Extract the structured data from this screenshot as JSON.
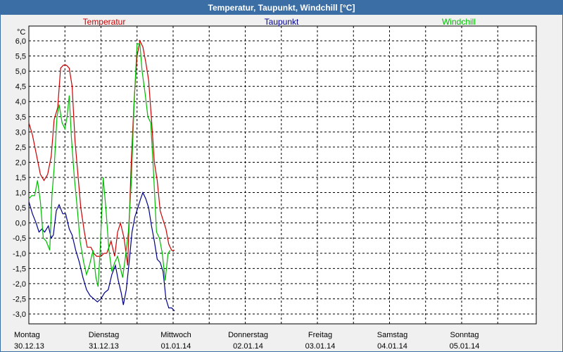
{
  "window": {
    "title": "Temperatur, Taupunkt, Windchill [°C]"
  },
  "chart_data": {
    "type": "line",
    "title": "Temperatur, Taupunkt, Windchill [°C]",
    "ylabel": "°C",
    "ylim": [
      -3.0,
      6.0
    ],
    "y_ticks": [
      "6,0",
      "5,5",
      "5,0",
      "4,5",
      "4,0",
      "3,5",
      "3,0",
      "2,5",
      "2,0",
      "1,5",
      "1,0",
      "0,5",
      "0,0",
      "-0,5",
      "-1,0",
      "-1,5",
      "-2,0",
      "-2,5",
      "-3,0"
    ],
    "xlim": [
      0,
      7
    ],
    "x_unit": "days from Montag 30.12.13",
    "x_ticks": [
      {
        "day": "Montag",
        "date": "30.12.13"
      },
      {
        "day": "Dienstag",
        "date": "31.12.13"
      },
      {
        "day": "Mittwoch",
        "date": "01.01.14"
      },
      {
        "day": "Donnerstag",
        "date": "02.01.14"
      },
      {
        "day": "Freitag",
        "date": "03.01.14"
      },
      {
        "day": "Samstag",
        "date": "04.01.14"
      },
      {
        "day": "Sonntag",
        "date": "05.01.14"
      }
    ],
    "grid": true,
    "legend_position": "top",
    "series": [
      {
        "name": "Temperatur",
        "color": "#cc0000",
        "points": [
          [
            0.0,
            3.3
          ],
          [
            0.05,
            2.9
          ],
          [
            0.1,
            2.3
          ],
          [
            0.16,
            1.6
          ],
          [
            0.21,
            1.4
          ],
          [
            0.26,
            1.6
          ],
          [
            0.31,
            2.2
          ],
          [
            0.35,
            3.4
          ],
          [
            0.4,
            3.8
          ],
          [
            0.44,
            5.1
          ],
          [
            0.48,
            5.2
          ],
          [
            0.52,
            5.2
          ],
          [
            0.56,
            5.1
          ],
          [
            0.6,
            4.5
          ],
          [
            0.64,
            2.7
          ],
          [
            0.68,
            1.6
          ],
          [
            0.72,
            0.5
          ],
          [
            0.77,
            -0.3
          ],
          [
            0.81,
            -0.8
          ],
          [
            0.86,
            -0.8
          ],
          [
            0.9,
            -1.0
          ],
          [
            0.94,
            -1.1
          ],
          [
            1.0,
            -1.1
          ],
          [
            1.04,
            -1.0
          ],
          [
            1.08,
            -1.0
          ],
          [
            1.14,
            -0.6
          ],
          [
            1.19,
            -1.1
          ],
          [
            1.23,
            -0.3
          ],
          [
            1.27,
            0.0
          ],
          [
            1.32,
            -0.5
          ],
          [
            1.37,
            -1.4
          ],
          [
            1.42,
            2.0
          ],
          [
            1.46,
            4.1
          ],
          [
            1.5,
            5.5
          ],
          [
            1.54,
            6.0
          ],
          [
            1.58,
            5.8
          ],
          [
            1.62,
            5.3
          ],
          [
            1.66,
            4.7
          ],
          [
            1.7,
            3.4
          ],
          [
            1.74,
            2.0
          ],
          [
            1.78,
            1.4
          ],
          [
            1.82,
            0.4
          ],
          [
            1.86,
            0.1
          ],
          [
            1.9,
            -0.2
          ],
          [
            1.94,
            -0.7
          ],
          [
            1.98,
            -0.9
          ],
          [
            2.02,
            -0.9
          ]
        ]
      },
      {
        "name": "Taupunkt",
        "color": "#00008b",
        "points": [
          [
            0.0,
            0.7
          ],
          [
            0.05,
            0.3
          ],
          [
            0.1,
            0.0
          ],
          [
            0.14,
            -0.3
          ],
          [
            0.18,
            -0.2
          ],
          [
            0.22,
            -0.3
          ],
          [
            0.27,
            -0.1
          ],
          [
            0.31,
            -0.5
          ],
          [
            0.34,
            -0.4
          ],
          [
            0.38,
            0.4
          ],
          [
            0.42,
            0.6
          ],
          [
            0.47,
            0.3
          ],
          [
            0.51,
            0.3
          ],
          [
            0.56,
            -0.2
          ],
          [
            0.6,
            -0.4
          ],
          [
            0.65,
            -0.9
          ],
          [
            0.7,
            -1.3
          ],
          [
            0.75,
            -1.8
          ],
          [
            0.8,
            -2.2
          ],
          [
            0.85,
            -2.4
          ],
          [
            0.9,
            -2.5
          ],
          [
            0.95,
            -2.6
          ],
          [
            1.0,
            -2.5
          ],
          [
            1.05,
            -2.3
          ],
          [
            1.1,
            -2.2
          ],
          [
            1.15,
            -1.7
          ],
          [
            1.2,
            -1.4
          ],
          [
            1.24,
            -1.9
          ],
          [
            1.28,
            -2.3
          ],
          [
            1.31,
            -2.7
          ],
          [
            1.35,
            -2.2
          ],
          [
            1.39,
            -1.3
          ],
          [
            1.43,
            -0.3
          ],
          [
            1.47,
            0.2
          ],
          [
            1.51,
            0.5
          ],
          [
            1.55,
            0.8
          ],
          [
            1.58,
            1.0
          ],
          [
            1.62,
            0.8
          ],
          [
            1.66,
            0.5
          ],
          [
            1.7,
            -0.1
          ],
          [
            1.74,
            -0.6
          ],
          [
            1.78,
            -1.2
          ],
          [
            1.82,
            -1.3
          ],
          [
            1.86,
            -1.6
          ],
          [
            1.9,
            -2.5
          ],
          [
            1.94,
            -2.8
          ],
          [
            1.98,
            -2.8
          ],
          [
            2.02,
            -2.9
          ]
        ]
      },
      {
        "name": "Windchill",
        "color": "#00bb00",
        "points": [
          [
            0.0,
            0.8
          ],
          [
            0.04,
            0.9
          ],
          [
            0.08,
            0.9
          ],
          [
            0.12,
            1.4
          ],
          [
            0.16,
            0.7
          ],
          [
            0.2,
            -0.5
          ],
          [
            0.24,
            -0.6
          ],
          [
            0.29,
            -0.9
          ],
          [
            0.32,
            0.9
          ],
          [
            0.35,
            1.8
          ],
          [
            0.39,
            3.5
          ],
          [
            0.42,
            3.9
          ],
          [
            0.46,
            3.3
          ],
          [
            0.5,
            3.1
          ],
          [
            0.53,
            3.5
          ],
          [
            0.56,
            4.2
          ],
          [
            0.59,
            2.8
          ],
          [
            0.63,
            1.5
          ],
          [
            0.67,
            0.5
          ],
          [
            0.71,
            -0.6
          ],
          [
            0.76,
            -1.3
          ],
          [
            0.8,
            -1.7
          ],
          [
            0.84,
            -1.4
          ],
          [
            0.89,
            -0.9
          ],
          [
            0.93,
            -1.8
          ],
          [
            0.96,
            -2.1
          ],
          [
            0.99,
            -0.8
          ],
          [
            1.03,
            1.5
          ],
          [
            1.07,
            0.4
          ],
          [
            1.11,
            -0.9
          ],
          [
            1.15,
            -1.6
          ],
          [
            1.19,
            -1.3
          ],
          [
            1.23,
            -1.1
          ],
          [
            1.27,
            -1.5
          ],
          [
            1.3,
            -1.8
          ],
          [
            1.34,
            -1.1
          ],
          [
            1.38,
            -0.3
          ],
          [
            1.42,
            1.3
          ],
          [
            1.46,
            4.0
          ],
          [
            1.5,
            5.9
          ],
          [
            1.54,
            5.9
          ],
          [
            1.57,
            5.0
          ],
          [
            1.61,
            4.3
          ],
          [
            1.65,
            3.5
          ],
          [
            1.69,
            3.3
          ],
          [
            1.73,
            1.6
          ],
          [
            1.77,
            -0.3
          ],
          [
            1.81,
            -0.5
          ],
          [
            1.85,
            -1.0
          ],
          [
            1.89,
            -1.9
          ],
          [
            1.93,
            -1.0
          ],
          [
            1.96,
            -0.9
          ]
        ]
      }
    ]
  }
}
